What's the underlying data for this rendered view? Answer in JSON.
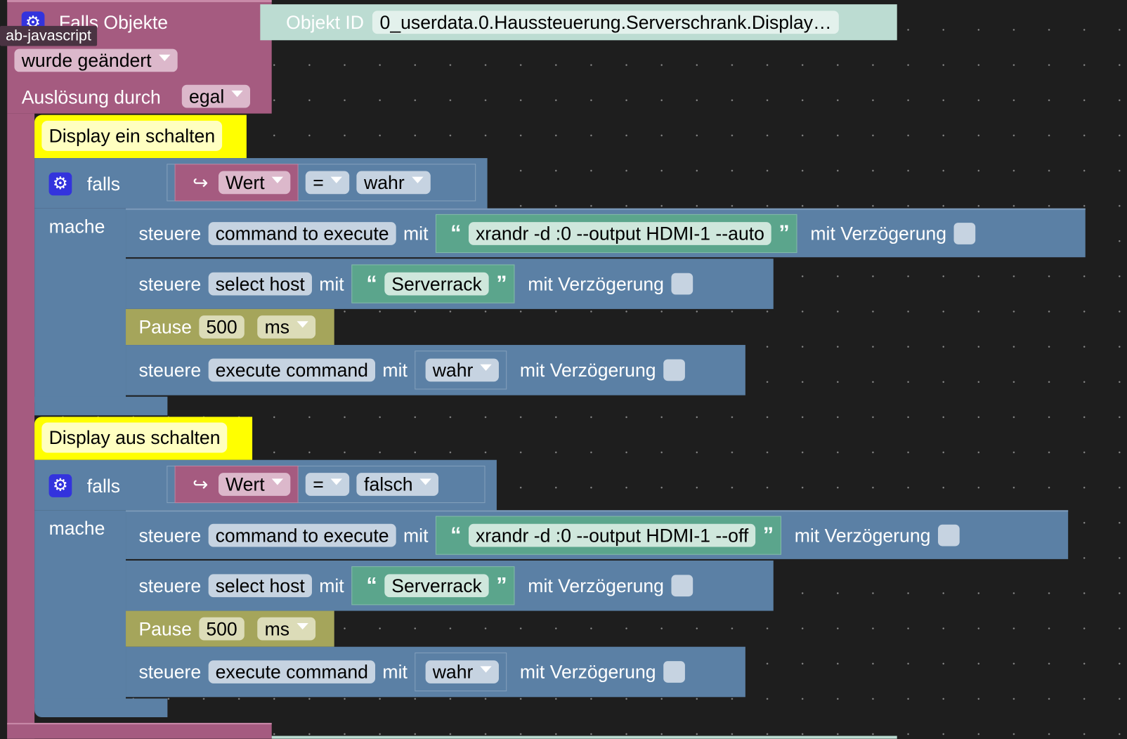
{
  "trigger": {
    "title": "Falls Objekte",
    "object_id_label": "Objekt ID",
    "object_id_value": "0_userdata.0.Haussteuerung.Serverschrank.Display…",
    "event": "wurde geändert",
    "trigger_by_label": "Auslösung durch",
    "trigger_by": "egal"
  },
  "tooltip": "ab-javascript",
  "groups": [
    {
      "comment": "Display ein schalten",
      "if_label": "falls",
      "do_label": "mache",
      "cond_var": "Wert",
      "cond_op": "=",
      "cond_value": "wahr",
      "cmds": [
        {
          "verb": "steuere",
          "target": "command to execute",
          "with": "mit",
          "value": "xrandr -d :0 --output HDMI-1 --auto",
          "delay": "mit Verzögerung"
        },
        {
          "verb": "steuere",
          "target": "select host",
          "with": "mit",
          "value": "Serverrack",
          "delay": "mit Verzögerung"
        },
        {
          "verb": "steuere",
          "target": "execute command",
          "with": "mit",
          "value": "wahr",
          "delay": "mit Verzögerung"
        }
      ],
      "pause": {
        "label": "Pause",
        "value": "500",
        "unit": "ms"
      }
    },
    {
      "comment": "Display aus schalten",
      "if_label": "falls",
      "do_label": "mache",
      "cond_var": "Wert",
      "cond_op": "=",
      "cond_value": "falsch",
      "cmds": [
        {
          "verb": "steuere",
          "target": "command to execute",
          "with": "mit",
          "value": "xrandr -d :0 --output HDMI-1 --off",
          "delay": "mit Verzögerung"
        },
        {
          "verb": "steuere",
          "target": "select host",
          "with": "mit",
          "value": "Serverrack",
          "delay": "mit Verzögerung"
        },
        {
          "verb": "steuere",
          "target": "execute command",
          "with": "mit",
          "value": "wahr",
          "delay": "mit Verzögerung"
        }
      ],
      "pause": {
        "label": "Pause",
        "value": "500",
        "unit": "ms"
      }
    }
  ],
  "colors": {
    "event_block": "#a55b80",
    "logic_block": "#5b80a5",
    "pause_block": "#a5a55b",
    "text_block": "#5ba58c",
    "comment": "#ffff00",
    "background": "#1e1e1e"
  }
}
